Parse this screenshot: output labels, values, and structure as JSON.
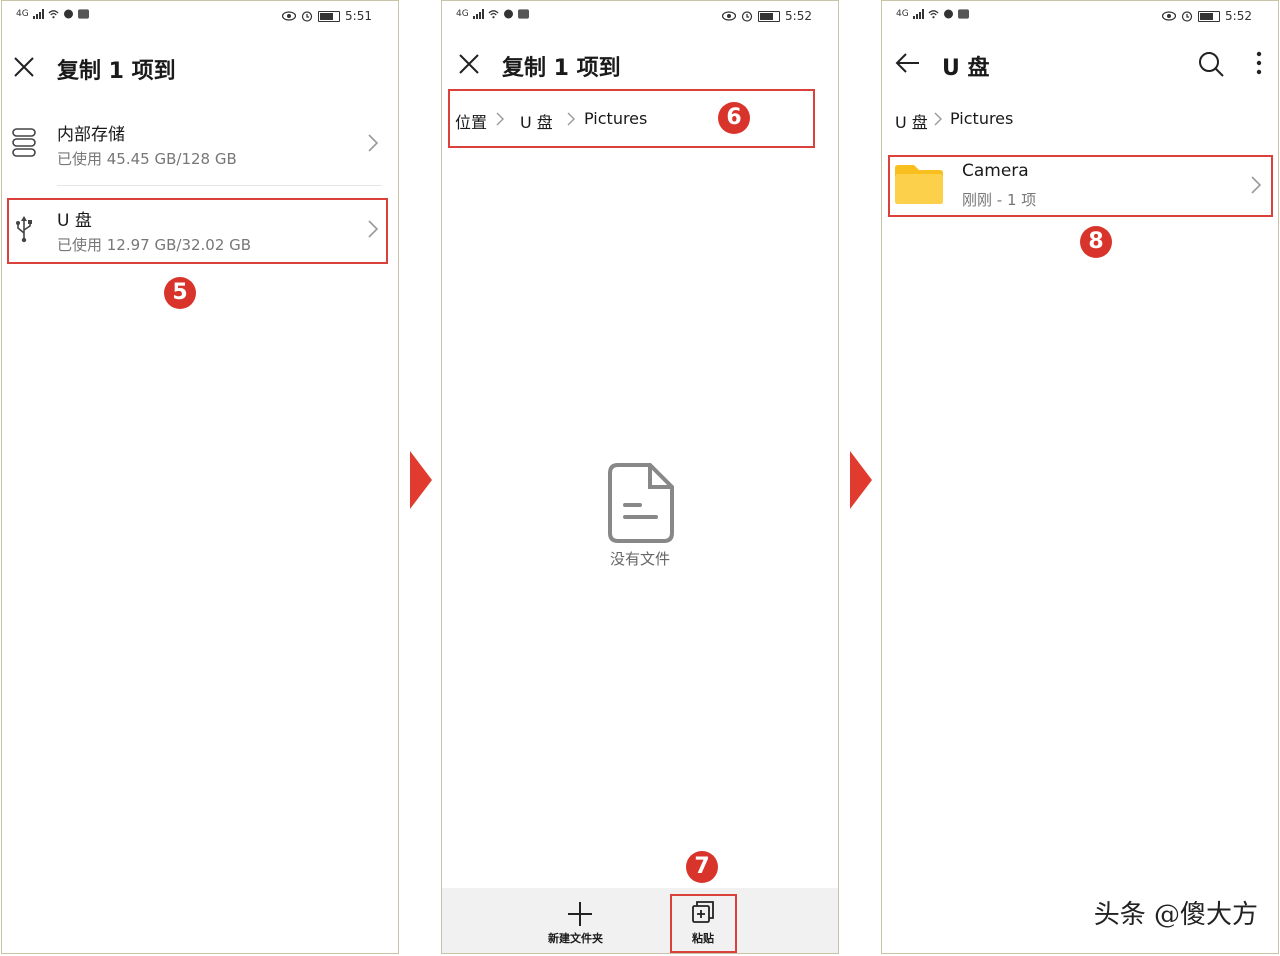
{
  "panel1": {
    "status": {
      "network": "4G",
      "time": "5:51"
    },
    "title": "复制 1 项到",
    "items": [
      {
        "name": "内部存储",
        "detail": "已使用 45.45 GB/128 GB",
        "icon": "storage-icon"
      },
      {
        "name": "U 盘",
        "detail": "已使用 12.97 GB/32.02 GB",
        "icon": "usb-icon"
      }
    ],
    "step": "5"
  },
  "panel2": {
    "status": {
      "network": "4G",
      "time": "5:52"
    },
    "title": "复制 1 项到",
    "breadcrumb": [
      "位置",
      "U 盘",
      "Pictures"
    ],
    "step_breadcrumb": "6",
    "empty_text": "没有文件",
    "bottom": {
      "new_folder": "新建文件夹",
      "paste": "粘贴"
    },
    "step_paste": "7"
  },
  "panel3": {
    "status": {
      "network": "4G",
      "time": "5:52"
    },
    "title": "U 盘",
    "breadcrumb": [
      "U 盘",
      "Pictures"
    ],
    "folder": {
      "name": "Camera",
      "detail": "刚刚 - 1 项",
      "icon": "folder-icon"
    },
    "step": "8"
  },
  "watermark": "头条 @傻大方",
  "colors": {
    "highlight": "#d9413a",
    "badge": "#d9342b",
    "arrow": "#e13a2e",
    "folder": "#f9bf1f"
  }
}
